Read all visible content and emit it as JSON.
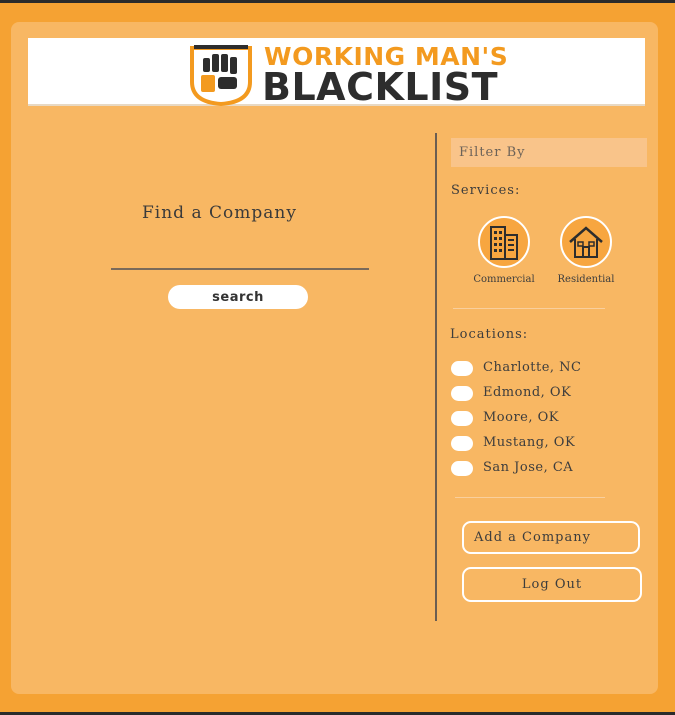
{
  "brand": {
    "line1": "WORKING MAN'S",
    "line2": "BLACKLIST"
  },
  "search": {
    "title": "Find a Company",
    "placeholder": "",
    "button_label": "search"
  },
  "filter": {
    "header": "Filter By",
    "services_label": "Services:",
    "services": [
      {
        "label": "Commercial",
        "icon": "building-icon"
      },
      {
        "label": "Residential",
        "icon": "house-icon"
      }
    ],
    "locations_label": "Locations:",
    "locations": [
      "Charlotte, NC",
      "Edmond, OK",
      "Moore, OK",
      "Mustang, OK",
      "San Jose, CA"
    ]
  },
  "actions": {
    "add_company": "Add a Company",
    "log_out": "Log Out"
  },
  "colors": {
    "background": "#f5a233",
    "panel": "#f8b763",
    "accent": "#f39a1f",
    "dark": "#2d2d2d"
  }
}
